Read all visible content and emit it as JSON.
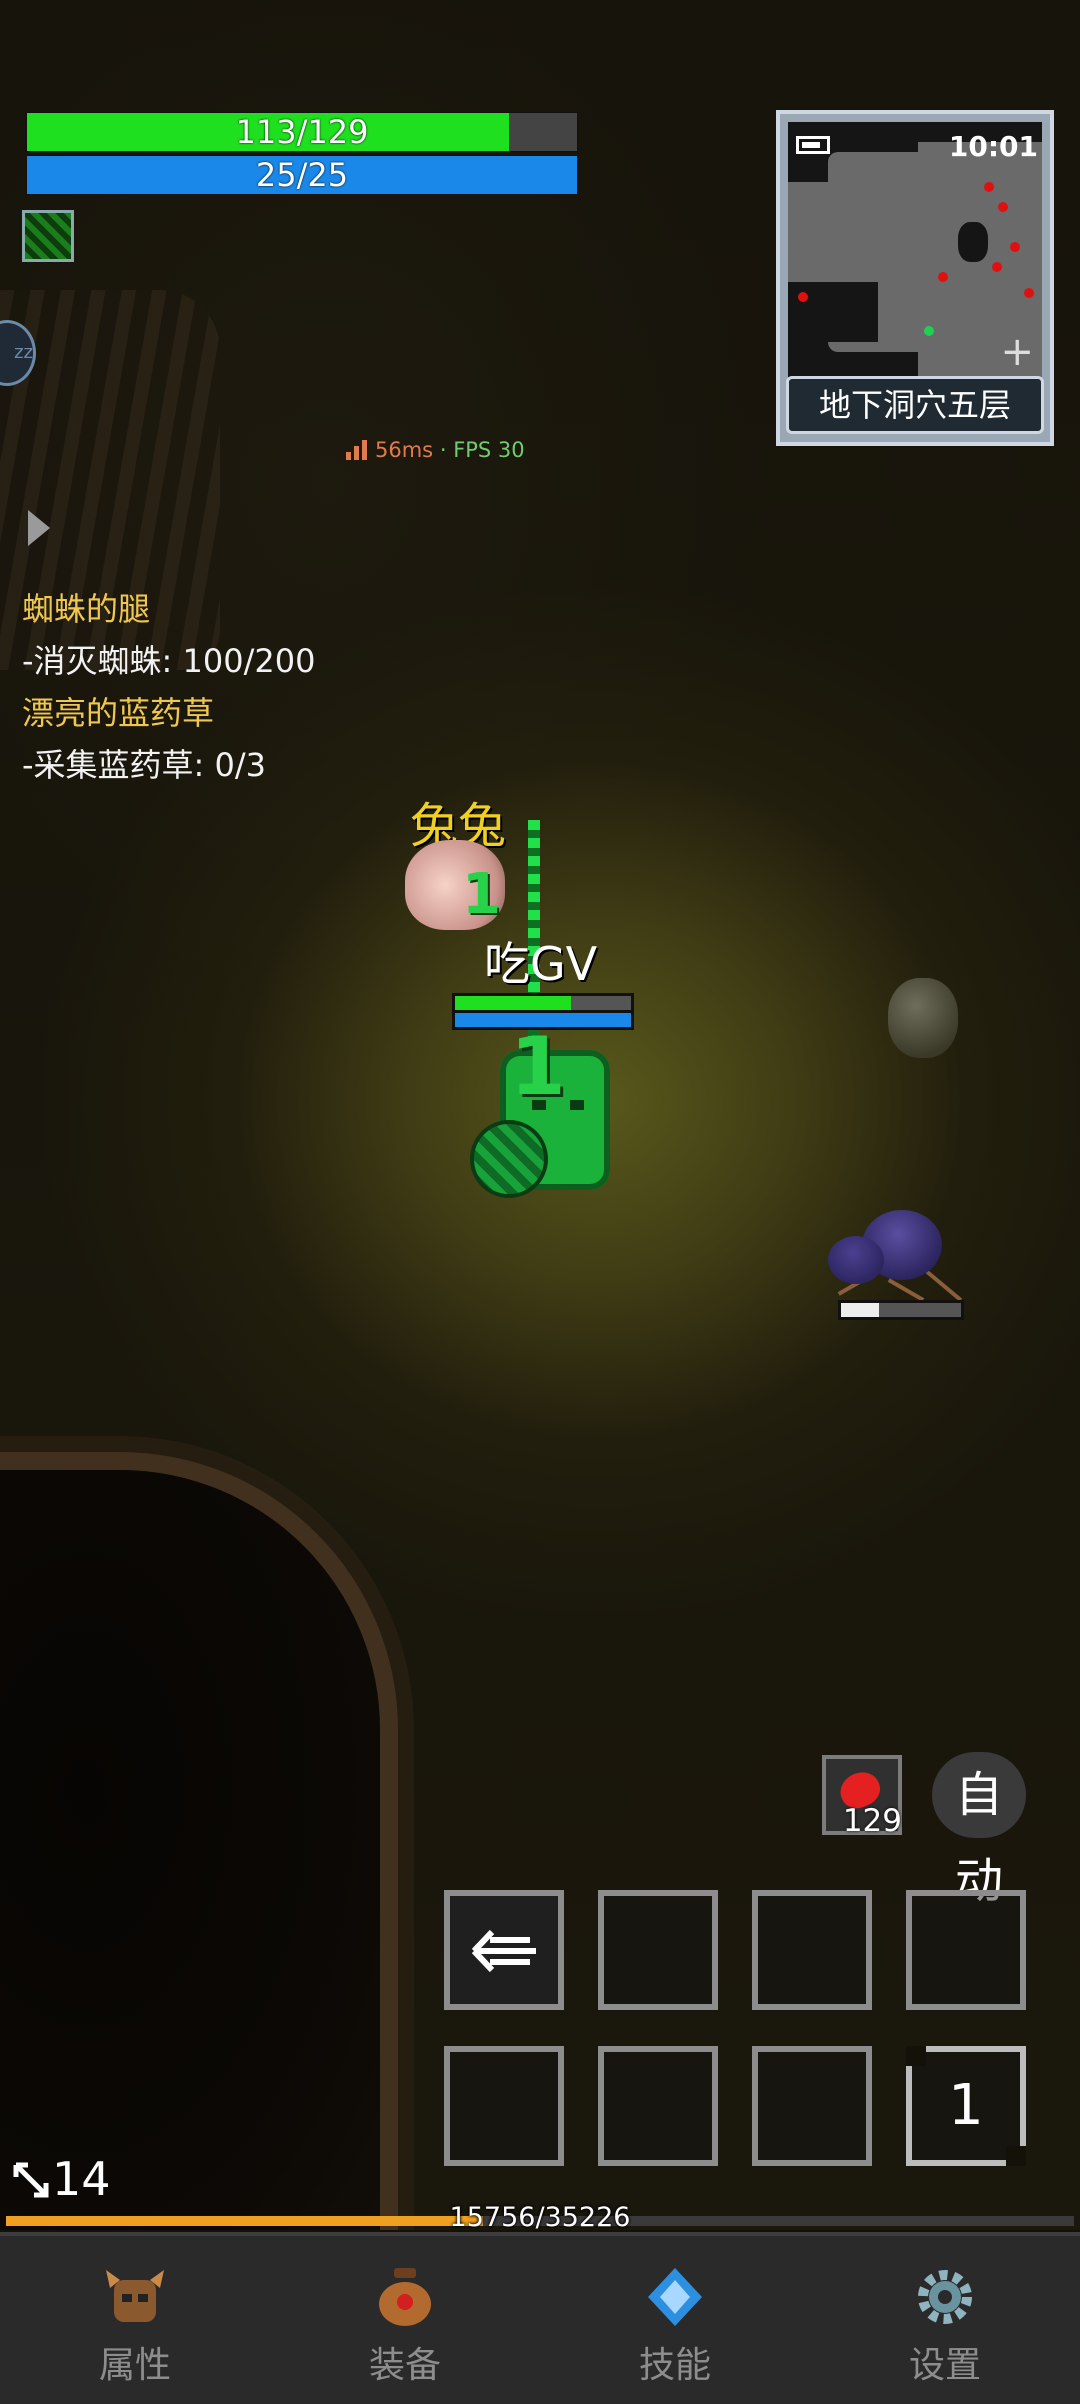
{
  "player": {
    "hp_text": "113/129",
    "hp_fraction": 0.876,
    "mp_text": "25/25",
    "mp_fraction": 1.0
  },
  "network": {
    "ping": "56ms",
    "separator": "·",
    "fps": "FPS 30"
  },
  "quests": [
    {
      "title": "蜘蛛的腿",
      "task": "-消灭蜘蛛: 100/200"
    },
    {
      "title": "漂亮的蓝药草",
      "task": "-采集蓝药草: 0/3"
    }
  ],
  "minimap": {
    "time": "10:01",
    "location": "地下洞穴五层",
    "zoom_label": "+"
  },
  "world": {
    "pet_name": "兔兔",
    "hero_name": "吃GV",
    "damage_large": "1",
    "damage_small": "1",
    "enemy_hp_fraction": 0.32,
    "colors": {
      "pet_name": "#f0d020",
      "hero_name": "#ffffff",
      "damage": "#27d14a"
    }
  },
  "hud": {
    "potion_count": "129",
    "auto_label": "自动",
    "slots": [
      {
        "name": "slot-1",
        "content": "arrow-skill-icon",
        "label": ""
      },
      {
        "name": "slot-2",
        "content": "",
        "label": ""
      },
      {
        "name": "slot-3",
        "content": "",
        "label": ""
      },
      {
        "name": "slot-4",
        "content": "",
        "label": ""
      },
      {
        "name": "slot-5",
        "content": "",
        "label": ""
      },
      {
        "name": "slot-6",
        "content": "",
        "label": ""
      },
      {
        "name": "slot-7",
        "content": "",
        "label": ""
      },
      {
        "name": "slot-8",
        "content": "page",
        "label": "1"
      }
    ],
    "level": "14",
    "xp_text": "15756/35226",
    "xp_fraction": 0.447
  },
  "nav": [
    {
      "label": "属性",
      "icon": "helmet-icon"
    },
    {
      "label": "装备",
      "icon": "bag-icon"
    },
    {
      "label": "技能",
      "icon": "skill-gem-icon"
    },
    {
      "label": "设置",
      "icon": "gear-icon"
    }
  ]
}
